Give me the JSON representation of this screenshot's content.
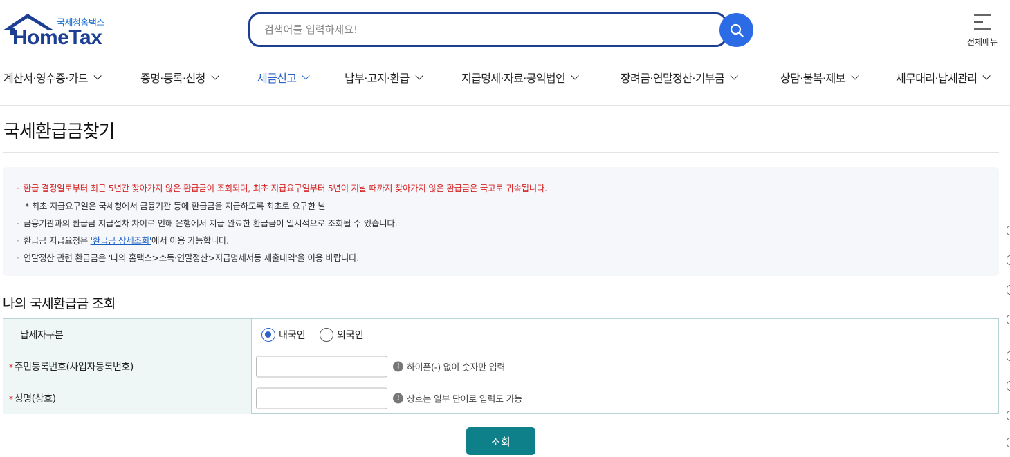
{
  "header": {
    "logo_sub": "국세청홈택스",
    "logo_main": "HomeTax",
    "search_placeholder": "검색어를 입력하세요!",
    "menu_label": "전체메뉴"
  },
  "nav": {
    "items": [
      {
        "label": "계산서·영수증·카드"
      },
      {
        "label": "증명·등록·신청"
      },
      {
        "label": "세금신고"
      },
      {
        "label": "납부·고지·환급"
      },
      {
        "label": "지급명세·자료·공익법인"
      },
      {
        "label": "장려금·연말정산·기부금"
      },
      {
        "label": "상담·불복·제보"
      },
      {
        "label": "세무대리·납세관리"
      }
    ],
    "active_index": 2
  },
  "page": {
    "title": "국세환급금찾기"
  },
  "notice": {
    "line1": "환급 결정일로부터 최근 5년간 찾아가지 않은 환급금이 조회되며, 최초 지급요구일부터 5년이 지날 때까지 찾아가지 않은 환급금은 국고로 귀속됩니다.",
    "line2": "* 최초 지급요구일은 국세청에서 금융기관 등에 환급금을 지급하도록 최초로 요구한 날",
    "line3": "금융기관과의 환급금 지급절차 차이로 인해 은행에서 지급 완료한 환급금이 일시적으로 조회될 수 있습니다.",
    "line4_prefix": "환급금 지급요청은 ",
    "line4_link": "'환급금 상세조회'",
    "line4_suffix": "에서 이용 가능합니다.",
    "line5": "연말정산 관련 환급금은 '나의 홈택스>소득·연말정산>지급명세서등 제출내역'을 이용 바랍니다.",
    "bullet": "·"
  },
  "section": {
    "title": "나의 국세환급금 조회"
  },
  "form": {
    "taxpayer_type_label": "납세자구분",
    "radio_domestic": "내국인",
    "radio_foreign": "외국인",
    "selected": "내국인",
    "id_label": "주민등록번호(사업자등록번호)",
    "id_value": "",
    "id_hint": "하이픈(-) 없이 숫자만 입력",
    "name_label": "성명(상호)",
    "name_value": "",
    "name_hint": "상호는 일부 단어로 입력도 가능",
    "required_mark": "*",
    "hint_icon": "!"
  },
  "submit_label": "조회",
  "colors": {
    "brand": "#1c3f94",
    "search_button": "#2b6be6",
    "active_nav": "#2b63c6",
    "warning_text": "#d52626",
    "submit_button": "#0e8089"
  }
}
